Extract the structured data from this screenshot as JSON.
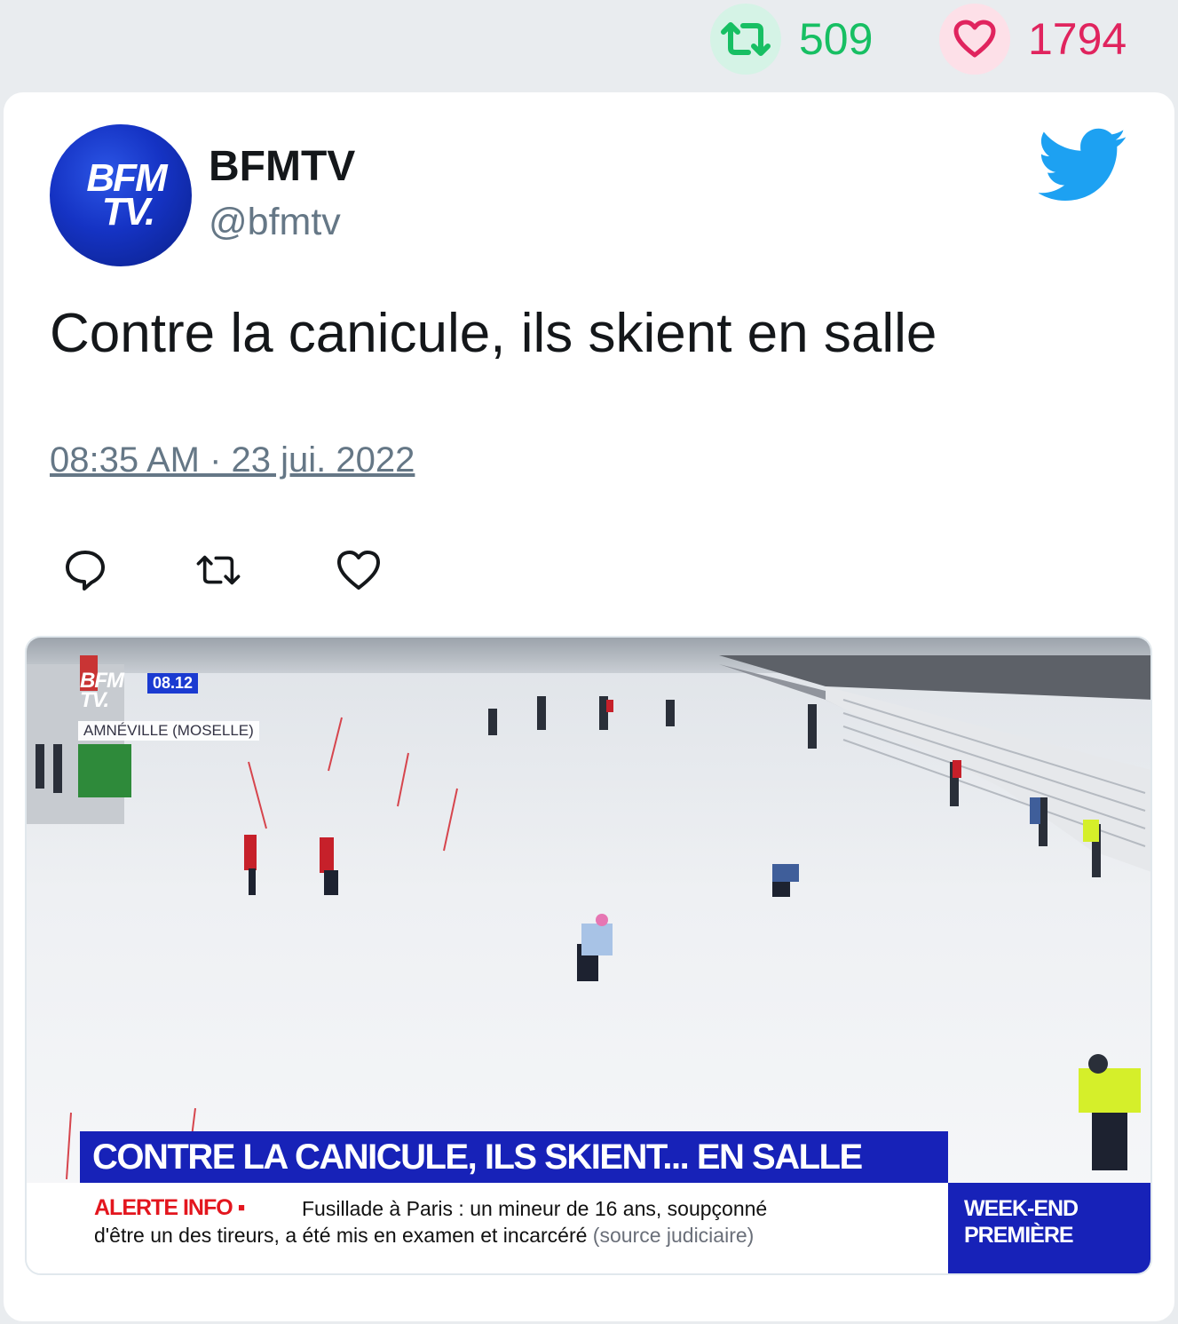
{
  "stats": {
    "retweets": "509",
    "likes": "1794",
    "retweet_icon": "retweet-icon",
    "like_icon": "heart-icon",
    "retweet_color": "#17bf63",
    "like_color": "#e0245e"
  },
  "tweet": {
    "author_name": "BFMTV",
    "author_handle": "@bfmtv",
    "avatar_text_line1": "BFM",
    "avatar_text_line2": "TV.",
    "text": "Contre la canicule, ils skient en salle",
    "timestamp": "08:35 AM · 23 jui. 2022",
    "actions": [
      "reply-icon",
      "retweet-icon",
      "heart-icon"
    ],
    "brand_icon": "twitter-bird-icon",
    "brand_color": "#1da1f2"
  },
  "media": {
    "channel_logo_line1": "BFM",
    "channel_logo_line2": "TV.",
    "clock": "08.12",
    "location": "AMNÉVILLE (MOSELLE)",
    "headline": "CONTRE LA CANICULE, ILS SKIENT... EN SALLE",
    "alert_label": "ALERTE INFO ▪",
    "alert_line1": "Fusillade à Paris : un mineur de 16 ans, soupçonné",
    "alert_line2": "d'être un des tireurs, a été mis en examen et incarcéré",
    "alert_source": "(source judiciaire)",
    "show_line1": "WEEK-END",
    "show_line2": "PREMIÈRE"
  }
}
